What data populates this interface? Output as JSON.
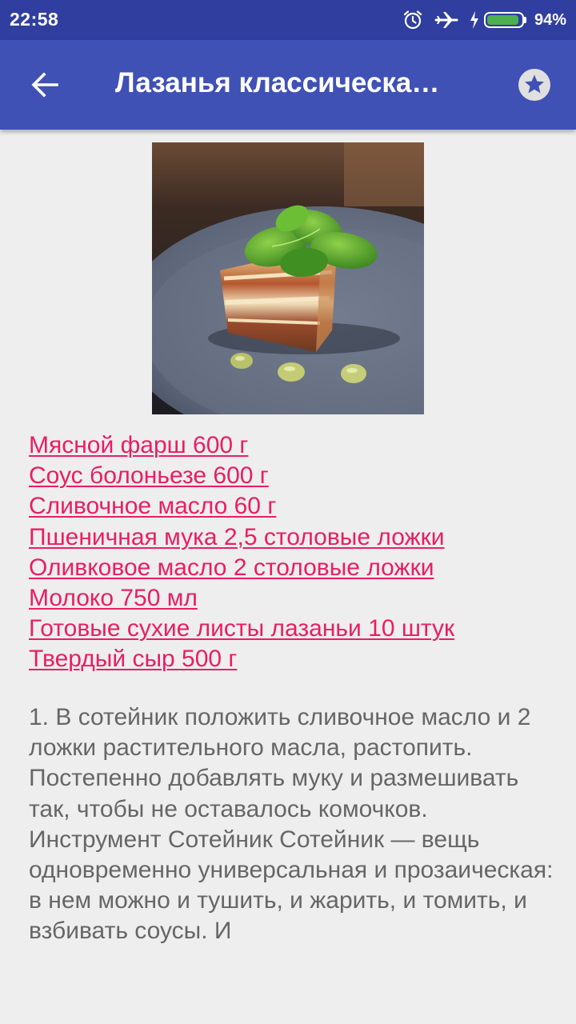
{
  "status_bar": {
    "time": "22:58",
    "battery_percent": "94%",
    "battery_level": 0.94,
    "icons": [
      "alarm-icon",
      "airplane-mode-icon",
      "charging-icon",
      "battery-icon"
    ]
  },
  "app_bar": {
    "title": "Лазанья классическа…",
    "back_icon": "arrow-back-icon",
    "favorite_icon": "star-icon"
  },
  "recipe": {
    "image_subject": "lasagna with basil",
    "ingredients": [
      "Мясной фарш 600 г",
      "Соус болоньезе 600 г",
      "Сливочное масло 60 г",
      "Пшеничная мука 2,5 столовые ложки",
      "Оливковое масло 2 столовые ложки",
      "Молоко 750 мл",
      "Готовые сухие листы лазаньи 10 штук",
      "Твердый сыр 500 г"
    ],
    "instructions": "1. В сотейник положить сливочное масло и 2 ложки растительного масла, растопить. Постепенно добавлять муку и размешивать так, чтобы не оставалось комочков. Инструмент Сотейник Сотейник — вещь одновременно универсальная и прозаическая: в нем можно и тушить, и жарить, и томить, и взбивать соусы. И"
  },
  "colors": {
    "status_bar": "#303f9f",
    "app_bar": "#3f51b5",
    "background": "#eeeeee",
    "link": "#e91e63",
    "body_text": "#666666",
    "battery": "#4caf50"
  }
}
